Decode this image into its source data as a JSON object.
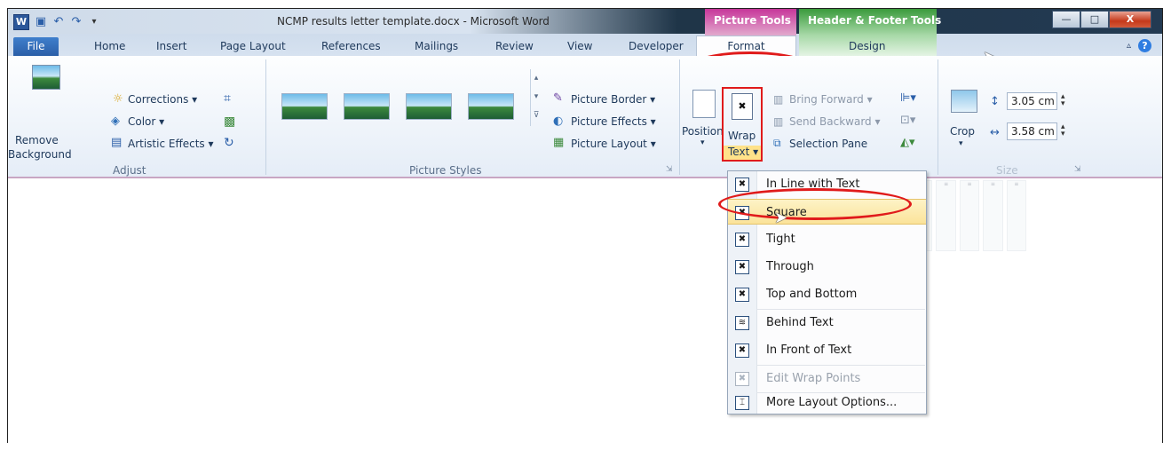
{
  "window": {
    "title": "NCMP results letter template.docx - Microsoft Word",
    "context_picture_tools": "Picture Tools",
    "context_header_footer_tools": "Header & Footer Tools",
    "minimize": "—",
    "maximize": "□",
    "close": "X"
  },
  "tabs": {
    "file": "File",
    "home": "Home",
    "insert": "Insert",
    "page_layout": "Page Layout",
    "references": "References",
    "mailings": "Mailings",
    "review": "Review",
    "view": "View",
    "developer": "Developer",
    "format": "Format",
    "design": "Design",
    "help": "?"
  },
  "ribbon": {
    "adjust": {
      "remove_background_line1": "Remove",
      "remove_background_line2": "Background",
      "corrections": "Corrections ▾",
      "color": "Color ▾",
      "artistic_effects": "Artistic Effects ▾",
      "group_label": "Adjust"
    },
    "picture_styles": {
      "border": "Picture Border ▾",
      "effects": "Picture Effects ▾",
      "layout": "Picture Layout ▾",
      "group_label": "Picture Styles"
    },
    "arrange": {
      "position": "Position",
      "wrap_line1": "Wrap",
      "wrap_line2": "Text ▾",
      "bring_forward": "Bring Forward ▾",
      "send_backward": "Send Backward ▾",
      "selection_pane": "Selection Pane"
    },
    "size": {
      "crop": "Crop",
      "height": "3.05 cm",
      "width": "3.58 cm",
      "group_label": "Size"
    }
  },
  "wrap_menu": {
    "items": [
      {
        "label": "In Line with Text",
        "icon": "inline-icon"
      },
      {
        "label": "Square",
        "icon": "square-wrap-icon"
      },
      {
        "label": "Tight",
        "icon": "tight-wrap-icon"
      },
      {
        "label": "Through",
        "icon": "through-wrap-icon"
      },
      {
        "label": "Top and Bottom",
        "icon": "top-bottom-wrap-icon"
      },
      {
        "label": "Behind Text",
        "icon": "behind-text-icon"
      },
      {
        "label": "In Front of Text",
        "icon": "in-front-text-icon"
      },
      {
        "label": "Edit Wrap Points",
        "icon": "edit-wrap-points-icon"
      },
      {
        "label": "More Layout Options...",
        "icon": "layout-options-icon"
      }
    ]
  },
  "colors": {
    "file_tab": "#2b5fa8",
    "picture_tools": "#c7369a",
    "header_footer_tools": "#3a9b3c",
    "highlight_ring": "#e01b1b",
    "menu_hover": "#fbe39a"
  }
}
